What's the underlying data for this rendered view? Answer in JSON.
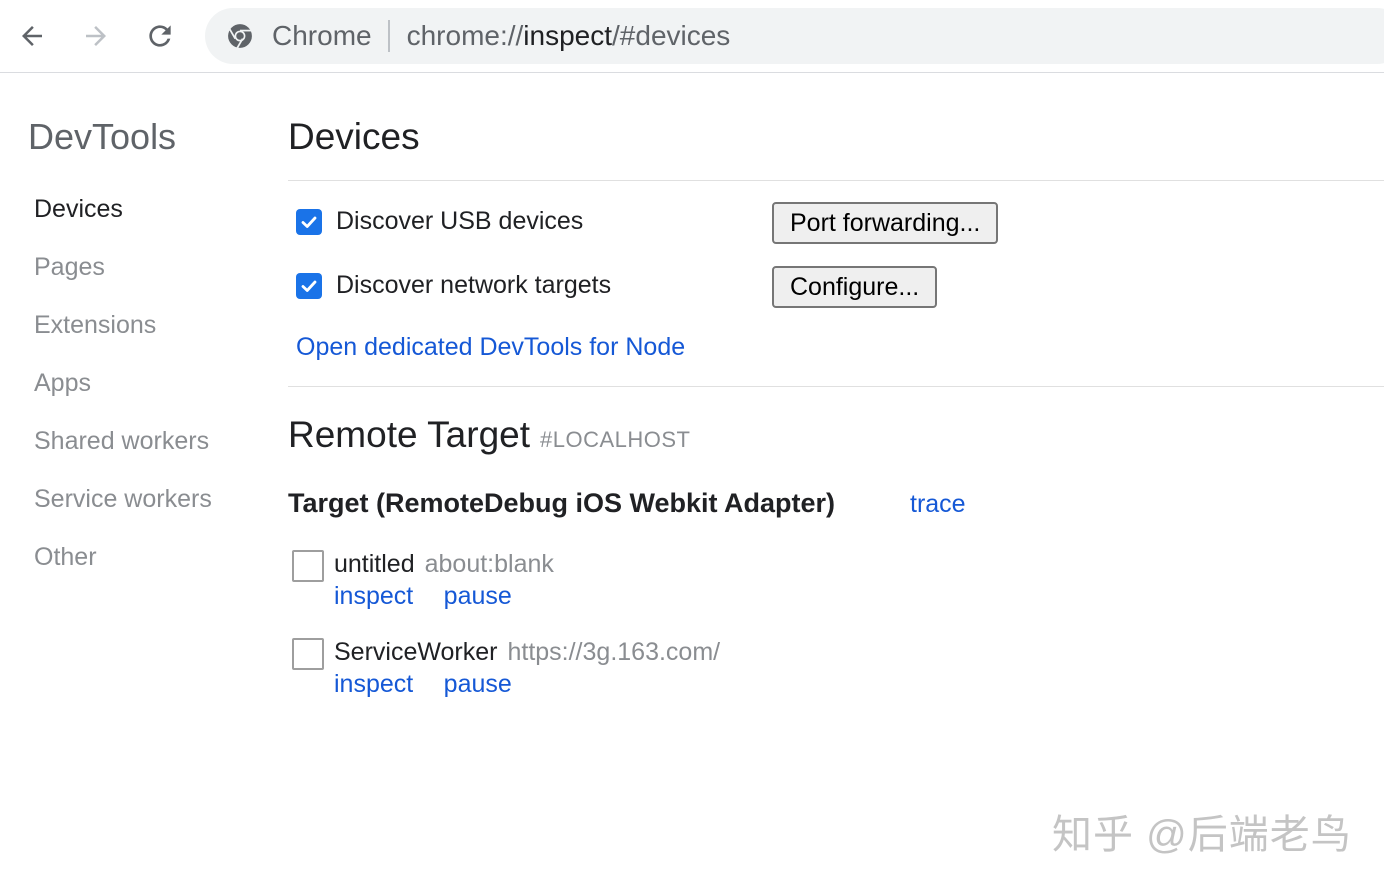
{
  "browser": {
    "back_icon": "arrow-left-icon",
    "forward_icon": "arrow-right-icon",
    "reload_icon": "reload-icon",
    "omnibox": {
      "chip_label": "Chrome",
      "url_scheme": "chrome://",
      "url_host": "inspect",
      "url_path": "/#devices"
    }
  },
  "sidebar": {
    "title": "DevTools",
    "items": [
      {
        "label": "Devices",
        "selected": true
      },
      {
        "label": "Pages",
        "selected": false
      },
      {
        "label": "Extensions",
        "selected": false
      },
      {
        "label": "Apps",
        "selected": false
      },
      {
        "label": "Shared workers",
        "selected": false
      },
      {
        "label": "Service workers",
        "selected": false
      },
      {
        "label": "Other",
        "selected": false
      }
    ]
  },
  "main": {
    "title": "Devices",
    "options": {
      "usb": {
        "label": "Discover USB devices",
        "checked": true,
        "button": "Port forwarding..."
      },
      "network": {
        "label": "Discover network targets",
        "checked": true,
        "button": "Configure..."
      }
    },
    "node_link": "Open dedicated DevTools for Node",
    "remote": {
      "title": "Remote Target",
      "subtitle": "#LOCALHOST",
      "target_name": "Target (RemoteDebug iOS Webkit Adapter)",
      "trace_link": "trace",
      "targets": [
        {
          "name": "untitled",
          "url": "about:blank",
          "inspect": "inspect",
          "pause": "pause"
        },
        {
          "name": "ServiceWorker",
          "url": "https://3g.163.com/",
          "inspect": "inspect",
          "pause": "pause"
        }
      ]
    }
  },
  "watermark": "知乎 @后端老鸟",
  "colors": {
    "link": "#1558d6",
    "checkbox": "#1a73e8",
    "muted_text": "#8a8d91"
  }
}
